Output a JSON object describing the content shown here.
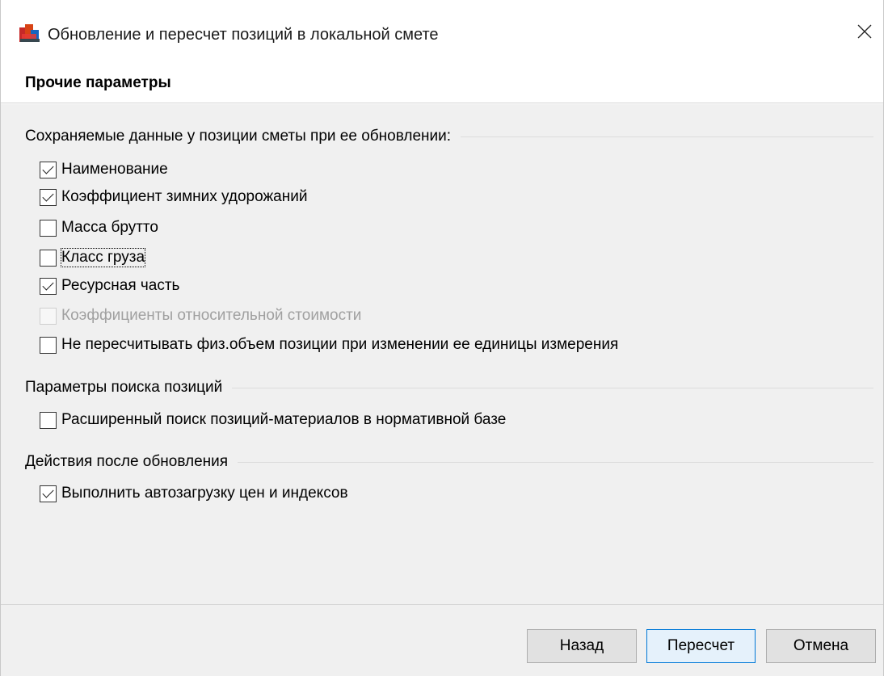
{
  "window": {
    "title": "Обновление и пересчет позиций в локальной смете",
    "icon": "app-icon"
  },
  "header": {
    "title": "Прочие параметры"
  },
  "groups": [
    {
      "label": "Сохраняемые данные у позиции сметы при ее обновлении:",
      "items": [
        {
          "label": "Наименование",
          "checked": true,
          "disabled": false
        },
        {
          "label": "Коэффициент зимних удорожаний",
          "checked": true,
          "disabled": false
        },
        {
          "label": "Масса брутто",
          "checked": false,
          "disabled": false
        },
        {
          "label": "Класс груза",
          "checked": false,
          "disabled": false,
          "focused": true
        },
        {
          "label": "Ресурсная часть",
          "checked": true,
          "disabled": false
        },
        {
          "label": "Коэффициенты относительной стоимости",
          "checked": false,
          "disabled": true
        },
        {
          "label": "Не пересчитывать физ.объем позиции при изменении ее единицы измерения",
          "checked": false,
          "disabled": false
        }
      ]
    },
    {
      "label": "Параметры поиска позиций",
      "items": [
        {
          "label": "Расширенный поиск позиций-материалов в нормативной базе",
          "checked": false,
          "disabled": false
        }
      ]
    },
    {
      "label": "Действия после обновления",
      "items": [
        {
          "label": "Выполнить автозагрузку цен и индексов",
          "checked": true,
          "disabled": false
        }
      ]
    }
  ],
  "footer": {
    "back_label": "Назад",
    "recalc_label": "Пересчет",
    "cancel_label": "Отмена"
  },
  "colors": {
    "accent": "#0078d7",
    "background": "#f0f0f0"
  }
}
